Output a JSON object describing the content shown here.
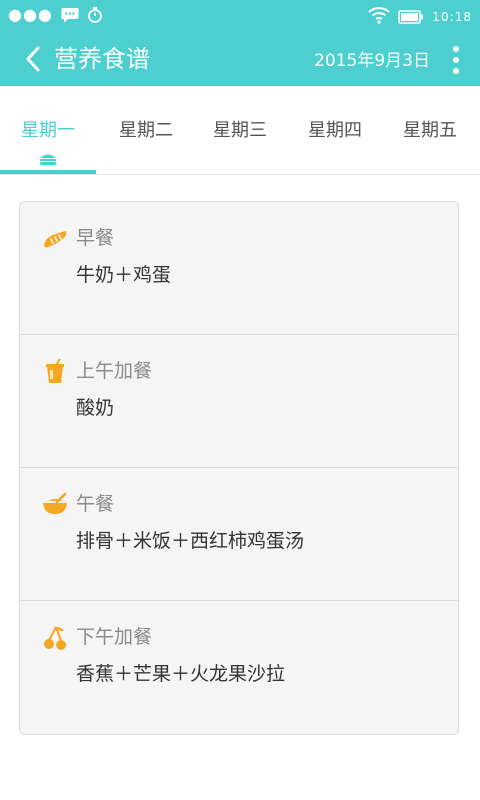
{
  "status_bar": {
    "time": "10:18",
    "signal_dots": "●●●",
    "icons": [
      "chat-icon",
      "stopwatch-icon",
      "wifi-icon",
      "battery-icon"
    ]
  },
  "header": {
    "title": "营养食谱",
    "date": "2015年9月3日"
  },
  "tabs": [
    {
      "label": "星期一",
      "active": true
    },
    {
      "label": "星期二",
      "active": false
    },
    {
      "label": "星期三",
      "active": false
    },
    {
      "label": "星期四",
      "active": false
    },
    {
      "label": "星期五",
      "active": false
    }
  ],
  "meals": [
    {
      "name": "早餐",
      "food": "牛奶＋鸡蛋",
      "icon": "bread-icon"
    },
    {
      "name": "上午加餐",
      "food": "酸奶",
      "icon": "drink-cup-icon"
    },
    {
      "name": "午餐",
      "food": "排骨＋米饭＋西红柿鸡蛋汤",
      "icon": "bowl-icon"
    },
    {
      "name": "下午加餐",
      "food": "香蕉＋芒果＋火龙果沙拉",
      "icon": "cherry-icon"
    }
  ],
  "colors": {
    "primary": "#4ecfcf",
    "accent_icon": "#f5a623"
  }
}
